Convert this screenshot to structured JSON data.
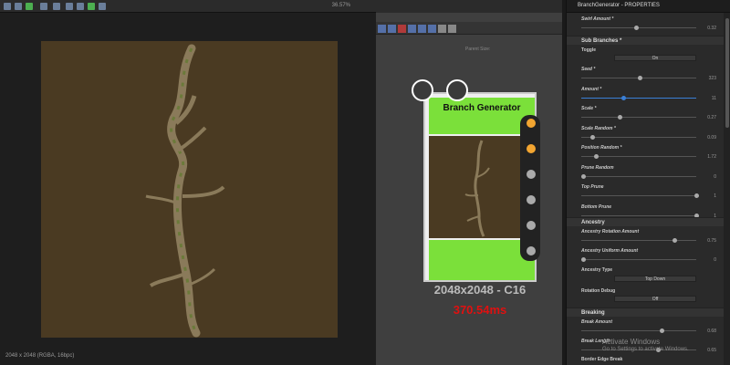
{
  "viewport": {
    "zoom": "36.57%",
    "status": "2048 x 2048 (RGBA, 16bpc)"
  },
  "graph": {
    "parent_size": "Parent Size:",
    "node_title": "Branch Generator",
    "resolution": "2048x2048 - C16",
    "time": "370.54ms",
    "colors": {
      "band": "#7be03a",
      "port_active": "#f2a531",
      "port_inactive": "#aaaaaa"
    }
  },
  "props": {
    "title": "BranchGenerator - PROPERTIES",
    "top_row": {
      "label": "Swirl Amount *",
      "value": "0.32"
    },
    "sub_branches": {
      "label": "Sub Branches *",
      "toggle_label": "Toggle",
      "toggle_value": "On",
      "rows": [
        {
          "label": "Seed *",
          "value": "323"
        },
        {
          "label": "Amount *",
          "value": "11"
        },
        {
          "label": "Scale *",
          "value": "0.27"
        },
        {
          "label": "Scale Random *",
          "value": "0.09"
        },
        {
          "label": "Position Random *",
          "value": "1.72"
        },
        {
          "label": "Prune Random",
          "value": "0"
        },
        {
          "label": "Top Prune",
          "value": "1"
        },
        {
          "label": "Bottom Prune",
          "value": "1"
        }
      ]
    },
    "ancestry": {
      "label": "Ancestry",
      "rows": [
        {
          "label": "Ancestry Rotation Amount",
          "value": "0.75"
        },
        {
          "label": "Ancestry Uniform Amount",
          "value": "0"
        }
      ],
      "type_label": "Ancestry Type",
      "type_value": "Top Down",
      "debug_label": "Rotation Debug",
      "debug_value": "Off"
    },
    "breaking": {
      "label": "Breaking",
      "rows": [
        {
          "label": "Break Amount",
          "value": "0.68"
        },
        {
          "label": "Break Length",
          "value": "0.65"
        }
      ],
      "last": "Border Edge Break"
    }
  },
  "watermark": {
    "line1": "Activate Windows",
    "line2": "Go to Settings to activate Windows."
  }
}
